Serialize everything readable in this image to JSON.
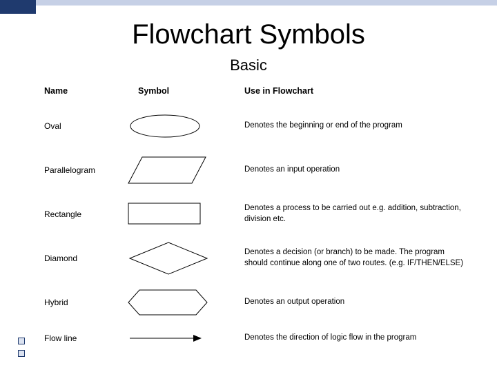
{
  "title": "Flowchart Symbols",
  "subtitle": "Basic",
  "headers": {
    "name": "Name",
    "symbol": "Symbol",
    "use": "Use in Flowchart"
  },
  "rows": [
    {
      "name": "Oval",
      "use": "Denotes the beginning or end of the program",
      "shape": "oval"
    },
    {
      "name": "Parallelogram",
      "use": "Denotes an input operation",
      "shape": "parallelogram"
    },
    {
      "name": "Rectangle",
      "use": "Denotes a process to be carried out e.g. addition, subtraction, division etc.",
      "shape": "rectangle"
    },
    {
      "name": "Diamond",
      "use": "Denotes a decision (or branch) to be made. The program should continue along one of two routes. (e.g. IF/THEN/ELSE)",
      "shape": "diamond"
    },
    {
      "name": "Hybrid",
      "use": "Denotes an output operation",
      "shape": "hybrid"
    },
    {
      "name": "Flow line",
      "use": "Denotes the direction of logic flow in the program",
      "shape": "arrow"
    }
  ]
}
